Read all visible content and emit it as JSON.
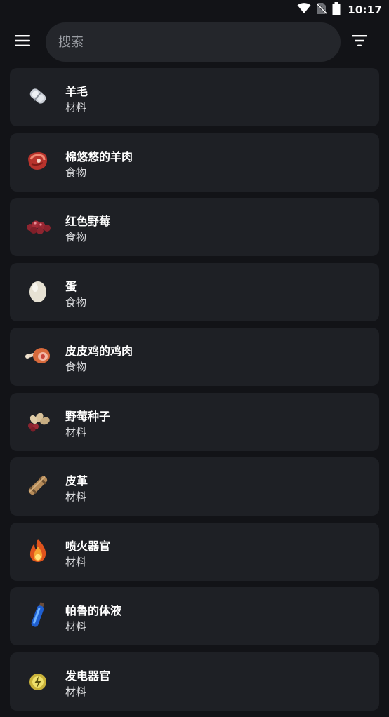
{
  "status_bar": {
    "time": "10:17",
    "icons": [
      "wifi-icon",
      "no-sim-icon",
      "battery-icon"
    ]
  },
  "top_bar": {
    "menu_icon": "hamburger-menu-icon",
    "search_placeholder": "搜索",
    "search_value": "",
    "filter_icon": "filter-icon"
  },
  "items": [
    {
      "name": "羊毛",
      "category": "材料",
      "icon": "wool-icon"
    },
    {
      "name": "棉悠悠的羊肉",
      "category": "食物",
      "icon": "mutton-icon"
    },
    {
      "name": "红色野莓",
      "category": "食物",
      "icon": "red-berries-icon"
    },
    {
      "name": "蛋",
      "category": "食物",
      "icon": "egg-icon"
    },
    {
      "name": "皮皮鸡的鸡肉",
      "category": "食物",
      "icon": "chicken-meat-icon"
    },
    {
      "name": "野莓种子",
      "category": "材料",
      "icon": "berry-seeds-icon"
    },
    {
      "name": "皮革",
      "category": "材料",
      "icon": "leather-icon"
    },
    {
      "name": "喷火器官",
      "category": "材料",
      "icon": "flame-organ-icon"
    },
    {
      "name": "帕鲁的体液",
      "category": "材料",
      "icon": "pal-fluid-icon"
    },
    {
      "name": "发电器官",
      "category": "材料",
      "icon": "electric-organ-icon"
    }
  ],
  "colors": {
    "background": "#121317",
    "card": "#1e2025",
    "search_bg": "#24262b",
    "text_primary": "#ffffff",
    "text_secondary": "#d9dadd",
    "placeholder": "#9b9ea4"
  }
}
